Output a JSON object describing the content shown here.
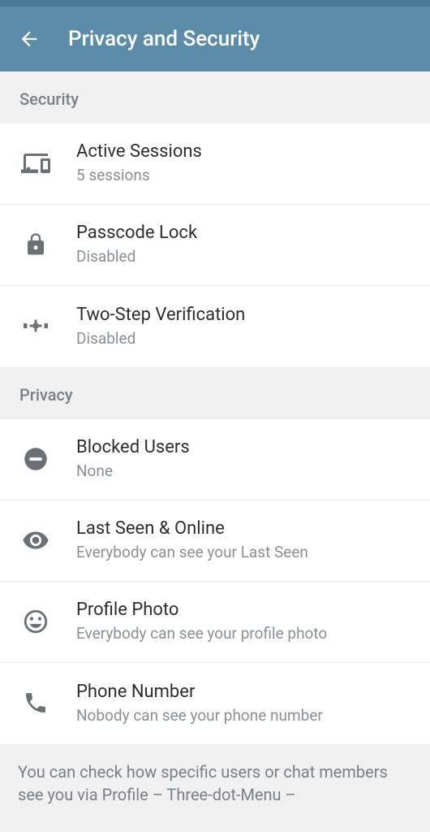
{
  "header": {
    "title": "Privacy and Security"
  },
  "sections": {
    "security": {
      "label": "Security",
      "items": {
        "active_sessions": {
          "title": "Active Sessions",
          "subtitle": "5 sessions"
        },
        "passcode_lock": {
          "title": "Passcode Lock",
          "subtitle": "Disabled"
        },
        "two_step": {
          "title": "Two-Step Verification",
          "subtitle": "Disabled"
        }
      }
    },
    "privacy": {
      "label": "Privacy",
      "items": {
        "blocked_users": {
          "title": "Blocked Users",
          "subtitle": "None"
        },
        "last_seen": {
          "title": "Last Seen & Online",
          "subtitle": "Everybody can see your Last Seen"
        },
        "profile_photo": {
          "title": "Profile Photo",
          "subtitle": "Everybody can see your profile photo"
        },
        "phone_number": {
          "title": "Phone Number",
          "subtitle": "Nobody can see your phone number"
        }
      }
    }
  },
  "footer": {
    "text": "You can check how specific users or chat members see you via Profile – Three-dot-Menu –"
  }
}
